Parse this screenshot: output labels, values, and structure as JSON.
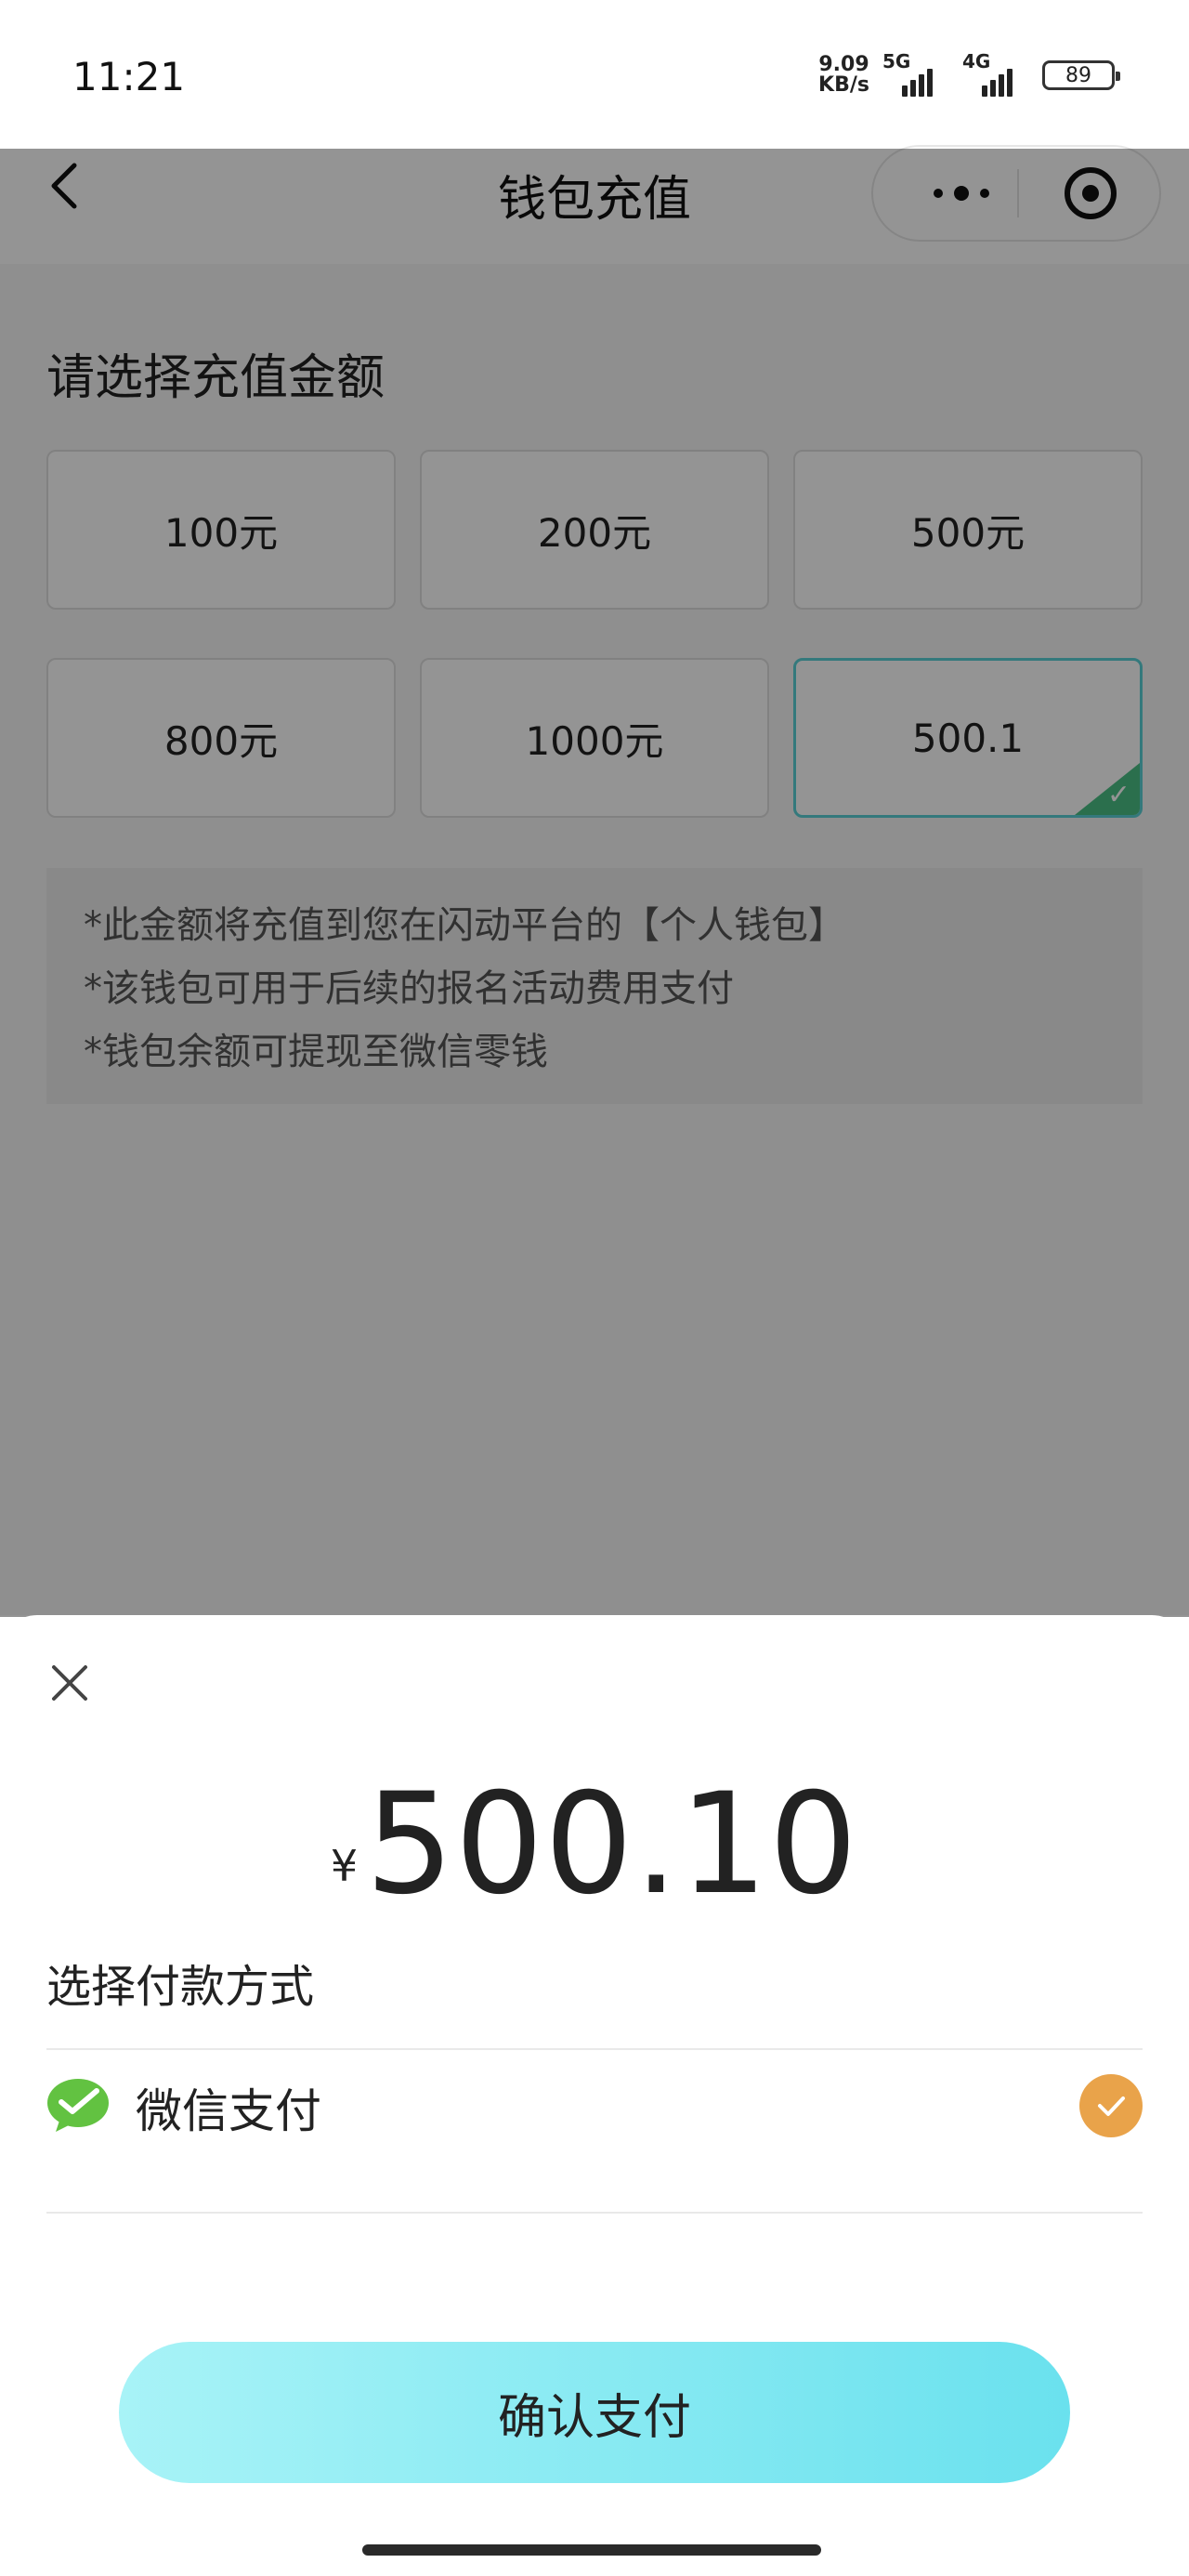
{
  "status_bar": {
    "time": "11:21",
    "net_speed_value": "9.09",
    "net_speed_unit": "KB/s",
    "signal_1": "5G",
    "signal_2": "4G",
    "battery": "89"
  },
  "nav": {
    "title": "钱包充值",
    "back_icon": "chevron-left-icon",
    "more_icon": "more-dots-icon",
    "close_icon": "target-icon"
  },
  "recharge": {
    "title": "请选择充值金额",
    "options": [
      {
        "label": "100元",
        "selected": false
      },
      {
        "label": "200元",
        "selected": false
      },
      {
        "label": "500元",
        "selected": false
      },
      {
        "label": "800元",
        "selected": false
      },
      {
        "label": "1000元",
        "selected": false
      },
      {
        "label": "500.1",
        "selected": true
      }
    ],
    "notes": [
      "*此金额将充值到您在闪动平台的【个人钱包】",
      "*该钱包可用于后续的报名活动费用支付",
      "*钱包余额可提现至微信零钱"
    ]
  },
  "sheet": {
    "currency": "¥",
    "amount": "500.10",
    "method_title": "选择付款方式",
    "method_label": "微信支付",
    "method_icon": "wechat-pay-icon",
    "confirm_label": "确认支付"
  },
  "colors": {
    "accent_check": "#e9a34a",
    "selected_border": "#5bd0d6",
    "selected_corner": "#4bbf86",
    "button_start": "#a8f3f7",
    "button_end": "#6ae1ee",
    "wechat_green": "#62c241"
  }
}
